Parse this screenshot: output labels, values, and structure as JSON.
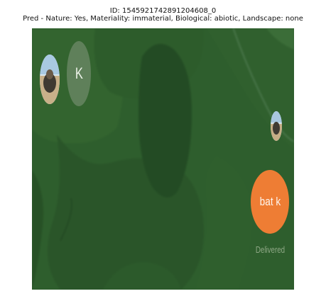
{
  "caption": {
    "id_line": "ID: 1545921742891204608_0",
    "pred_line": "Pred - Nature: Yes, Materiality: immaterial, Biological: abiotic, Landscape: none"
  },
  "chat": {
    "contact_initial": "K",
    "message_text": "bat k",
    "message_status": "Delivered"
  },
  "colors": {
    "background_green": "#2b5a2b",
    "initial_bubble": "#5f805a",
    "message_bubble": "#ee7d34",
    "status_text": "#8fa886"
  },
  "icons": {
    "left_avatar": "profile-photo-avatar",
    "right_avatar": "profile-photo-avatar"
  }
}
